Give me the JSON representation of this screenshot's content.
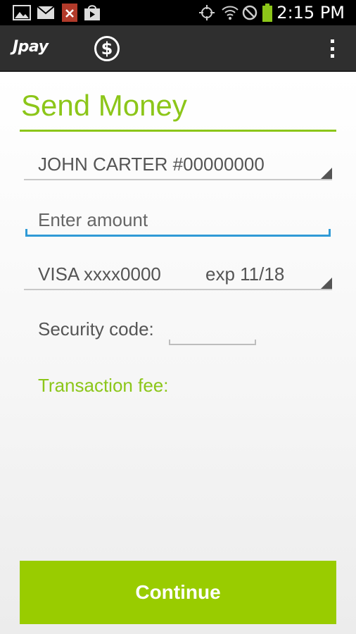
{
  "status_bar": {
    "time": "2:15 PM",
    "icons": [
      "gallery-icon",
      "gmail-icon",
      "pdf-icon",
      "play-store-icon",
      "gps-icon",
      "wifi-icon",
      "no-signal-icon",
      "battery-icon"
    ]
  },
  "action_bar": {
    "logo": "Jpay",
    "dollar_glyph": "$",
    "menu_icon": "overflow-menu-icon"
  },
  "main": {
    "title": "Send Money",
    "recipient": "JOHN CARTER #00000000",
    "amount_placeholder": "Enter amount",
    "card_number": "VISA xxxx0000",
    "card_exp": "exp 11/18",
    "security_label": "Security code:",
    "transaction_fee_label": "Transaction fee:",
    "continue_label": "Continue"
  },
  "colors": {
    "accent_green": "#8cc619",
    "button_green": "#99cc00",
    "focus_blue": "#2f9ad6",
    "action_bar": "#2f2f2f"
  }
}
